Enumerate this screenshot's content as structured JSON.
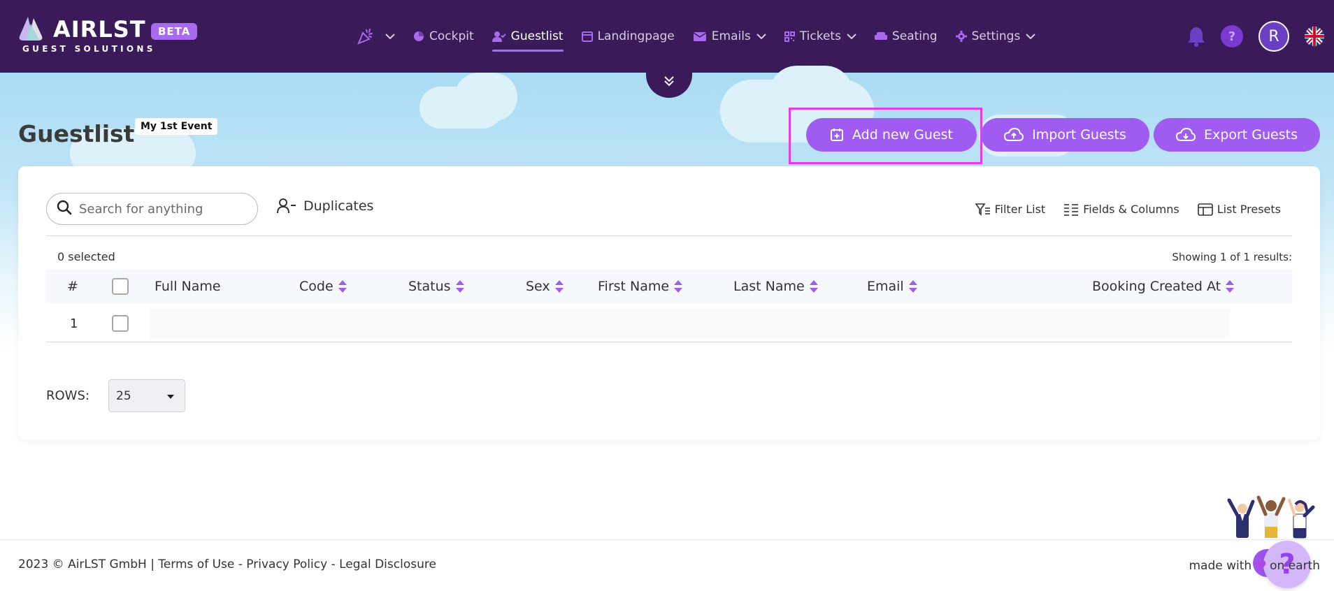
{
  "brand": {
    "name": "AIRLST",
    "subtitle": "GUEST SOLUTIONS",
    "badge": "BETA"
  },
  "nav": {
    "items": [
      {
        "label": "",
        "icon": "party-popper-icon",
        "dropdown": true
      },
      {
        "label": "Cockpit",
        "icon": "pie-chart-icon"
      },
      {
        "label": "Guestlist",
        "icon": "user-check-icon",
        "active": true
      },
      {
        "label": "Landingpage",
        "icon": "browser-window-icon"
      },
      {
        "label": "Emails",
        "icon": "envelope-icon",
        "dropdown": true
      },
      {
        "label": "Tickets",
        "icon": "qr-code-icon",
        "dropdown": true
      },
      {
        "label": "Seating",
        "icon": "armchair-icon"
      },
      {
        "label": "Settings",
        "icon": "gear-icon",
        "dropdown": true
      }
    ],
    "right": {
      "help": "?",
      "avatar_initial": "R",
      "language": "en-GB"
    }
  },
  "page": {
    "title": "Guestlist",
    "event_tag": "My 1st Event"
  },
  "actions": {
    "add_guest": "Add new Guest",
    "import_guests": "Import Guests",
    "export_guests": "Export Guests"
  },
  "toolbar": {
    "search_placeholder": "Search for anything",
    "duplicates": "Duplicates",
    "filter_list": "Filter List",
    "fields_columns": "Fields & Columns",
    "list_presets": "List Presets"
  },
  "table": {
    "selected": "0 selected",
    "showing": "Showing 1 of 1 results:",
    "columns": {
      "num": "#",
      "full_name": "Full Name",
      "code": "Code",
      "status": "Status",
      "sex": "Sex",
      "first_name": "First Name",
      "last_name": "Last Name",
      "email": "Email",
      "booking_created_at": "Booking Created At"
    },
    "rows": [
      {
        "num": "1"
      }
    ]
  },
  "pagination": {
    "rows_label": "ROWS:",
    "rows_value": "25"
  },
  "help_fab": "?",
  "footer": {
    "copyright": "2023 © AirLST GmbH",
    "sep": "|",
    "terms": "Terms of Use",
    "dash": "-",
    "privacy": "Privacy Policy",
    "legal": "Legal Disclosure",
    "made_with": "made with",
    "on_earth": "on earth"
  },
  "colors": {
    "nav_bg": "#3a1a59",
    "accent": "#a05cf0",
    "highlight_outline": "#e43ce8"
  }
}
